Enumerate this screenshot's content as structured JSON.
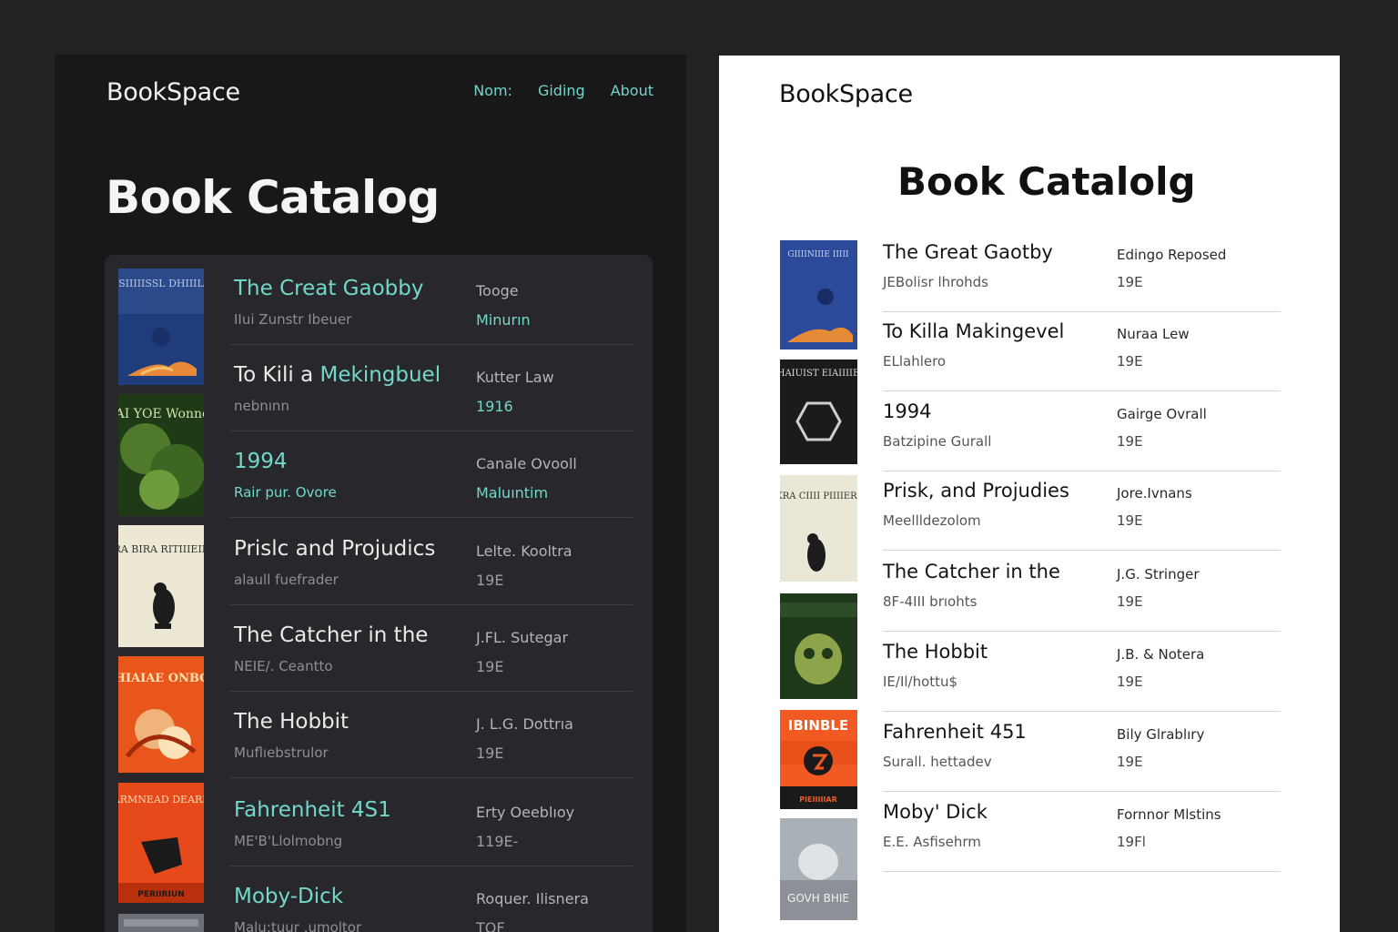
{
  "dark": {
    "logo": "BookSpace",
    "nav": [
      "Nom:",
      "Giding",
      "About"
    ],
    "title": "Book Catalog",
    "books": [
      {
        "title": "The Creat Gaobby",
        "title_pre": "",
        "sub": "IIui Zunstr Ibeuer",
        "author": "Tooge",
        "year": "Minurın",
        "year_accent": true,
        "cover": "great-gatsby-cover"
      },
      {
        "title": "Mekingbuel",
        "title_pre": "To Kili a ",
        "sub": "nebnınn",
        "author": "Kutter Law",
        "year": "1916",
        "year_accent": true,
        "cover": "mockingbird-cover"
      },
      {
        "title": "1994",
        "title_pre": "",
        "sub": "Rair pur. Ovore",
        "author": "Canale Ovooll",
        "year": "Maluıntim",
        "year_accent": true,
        "cover": "1984-cover"
      },
      {
        "title": "Prislc and Projudics",
        "title_pre": "",
        "sub": "alaull fuefrader",
        "author": "Lelte. Kooltra",
        "year": "19E",
        "year_accent": false,
        "cover": "pride-prejudice-cover"
      },
      {
        "title": "The Catcher in the",
        "title_pre": "",
        "sub": "NEIE/. Ceantto",
        "author": "J.FL. Sutegar",
        "year": "19E",
        "year_accent": false,
        "cover": "catcher-rye-cover"
      },
      {
        "title": "The Hobbit",
        "title_pre": "",
        "sub": "Muflıebstrulor",
        "author": "J. L.G. Dottrıa",
        "year": "19E",
        "year_accent": false,
        "cover": "hobbit-cover"
      },
      {
        "title": "Fahrenheit 4S1",
        "title_pre": "",
        "sub": "ME'B'Llolmobng",
        "author": "Erty Oeeblıoy",
        "year": "119E-",
        "year_accent": false,
        "cover": "fahrenheit-cover"
      },
      {
        "title": "Moby-Dick",
        "title_pre": "",
        "sub": "Malu:tuur .umoltor",
        "author": "Roquer. Ilisnera",
        "year": "TOF",
        "year_accent": false,
        "cover": "moby-dick-cover"
      }
    ],
    "cover_labels": [
      "SIIIIISSL DHIIIL",
      "DrAI YOE Wonnere",
      "RKRA BIRA RITIIIEIBIIT",
      "OIHIAIAE ONBOIL",
      "DEARMNEAD DEARIEIE",
      "PERIIRIUN"
    ]
  },
  "light": {
    "logo": "BookSpace",
    "title": "Book Catalolg",
    "books": [
      {
        "title": "The Great Gaotby",
        "sub": "JEBolisr lhrohds",
        "author": "Edingo Reposed",
        "year": "19E",
        "cover": "great-gatsby-cover"
      },
      {
        "title": "To Killa Makingevel",
        "sub": "ELlahlero",
        "author": "Nuraa Lew",
        "year": "19E",
        "cover": "mockingbird-cover"
      },
      {
        "title": "1994",
        "sub": "Batzipine Gurall",
        "author": "Gairge Ovrall",
        "year": "19E",
        "cover": "1984-cover"
      },
      {
        "title": "Prisk, and Projudies",
        "sub": "Meellldezolom",
        "author": "Jore.Ivnans",
        "year": "19E",
        "cover": "pride-prejudice-cover"
      },
      {
        "title": "The Catcher in the",
        "sub": "8F-4III brıohts",
        "author": "J.G. Stringer",
        "year": "19E",
        "cover": "catcher-rye-cover"
      },
      {
        "title": "The Hobbit",
        "sub": "IE/Il/hottu$",
        "author": "J.B. & Notera",
        "year": "19E",
        "cover": "hobbit-cover"
      },
      {
        "title": "Fahrenheit 451",
        "sub": "Surall. hettadev",
        "author": "Bily Glrablıry",
        "year": "19E",
        "cover": "fahrenheit-cover"
      },
      {
        "title": "Moby' Dick",
        "sub": "E.E. Asfisehrm",
        "author": "Fornnor Mlstins",
        "year": "19Fl",
        "cover": "moby-dick-cover"
      }
    ],
    "cover_labels": [
      "GIIIINIIIE IIIII",
      "HAIUIST EIAIIIIE",
      "RAKRA CIIII PIIIIERRIE",
      "IBINBLE",
      "PIEIIIIIAR",
      "GOVH BHIE"
    ]
  },
  "colors": {
    "accent_teal": "#72d8ca",
    "dark_bg": "#18181a",
    "dark_card": "#28282c",
    "light_bg": "#ffffff"
  }
}
